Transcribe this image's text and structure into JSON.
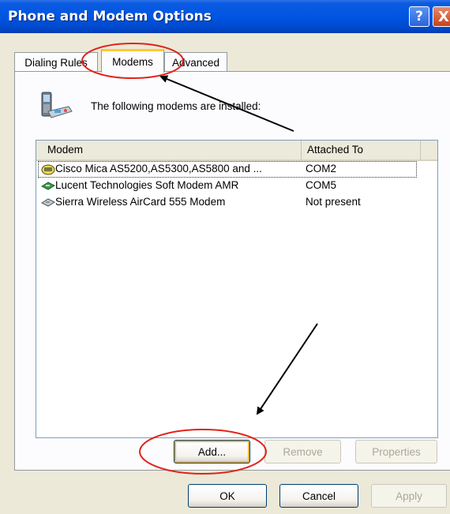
{
  "window": {
    "title": "Phone and Modem Options"
  },
  "titlebar_buttons": {
    "help": "?",
    "close": "X"
  },
  "tabs": [
    {
      "label": "Dialing Rules"
    },
    {
      "label": "Modems"
    },
    {
      "label": "Advanced"
    }
  ],
  "active_tab": "Modems",
  "main": {
    "installed_text": "The following modems are installed:",
    "list": {
      "columns": [
        "Modem",
        "Attached To"
      ],
      "rows": [
        {
          "modem": "Cisco Mica AS5200,AS5300,AS5800 and ...",
          "attached_to": "COM2",
          "selected": true
        },
        {
          "modem": "Lucent Technologies Soft Modem AMR",
          "attached_to": "COM5",
          "selected": false
        },
        {
          "modem": "Sierra Wireless AirCard 555 Modem",
          "attached_to": "Not present",
          "selected": false
        }
      ]
    },
    "buttons": {
      "add": "Add...",
      "remove": "Remove",
      "properties": "Properties"
    }
  },
  "footer": {
    "ok": "OK",
    "cancel": "Cancel",
    "apply": "Apply"
  },
  "icons": [
    "modem-phone-icon",
    "modem-device-icon",
    "help-icon",
    "close-icon"
  ],
  "colors": {
    "titlebar": "#0055E3",
    "dialog": "#ECE9D8",
    "annotation": "#E2231A",
    "active_tab_accent": "#FFC83C"
  }
}
